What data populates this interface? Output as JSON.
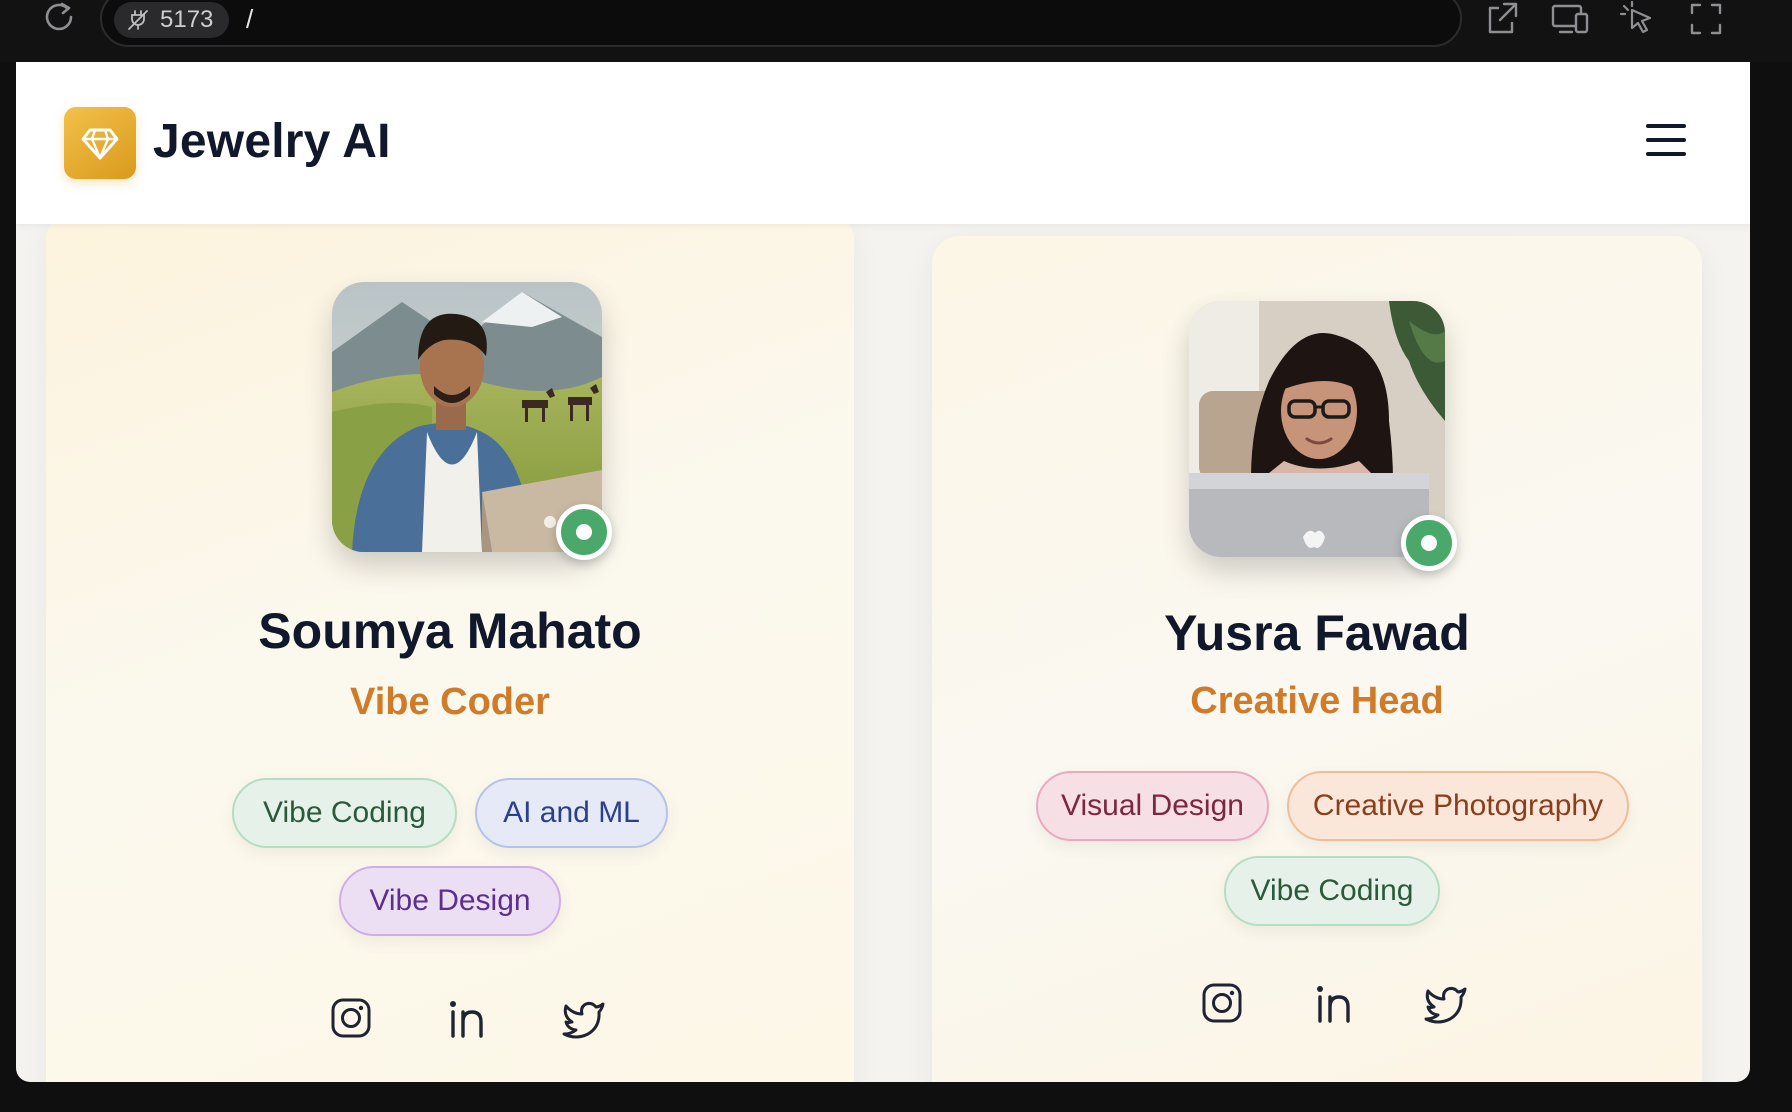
{
  "browser": {
    "port": "5173",
    "path": "/"
  },
  "app": {
    "title": "Jewelry AI",
    "accent": "#e0a52a"
  },
  "team": [
    {
      "name": "Soumya Mahato",
      "role": "Vibe Coder",
      "status": "online",
      "tags": [
        {
          "label": "Vibe Coding",
          "color": "green"
        },
        {
          "label": "AI and ML",
          "color": "blue"
        },
        {
          "label": "Vibe Design",
          "color": "purple"
        }
      ],
      "socials": [
        "instagram-icon",
        "linkedin-icon",
        "twitter-icon"
      ]
    },
    {
      "name": "Yusra Fawad",
      "role": "Creative Head",
      "status": "online",
      "tags": [
        {
          "label": "Visual Design",
          "color": "pink"
        },
        {
          "label": "Creative Photography",
          "color": "orange"
        },
        {
          "label": "Vibe Coding",
          "color": "green"
        }
      ],
      "socials": [
        "instagram-icon",
        "linkedin-icon",
        "twitter-icon"
      ]
    }
  ]
}
